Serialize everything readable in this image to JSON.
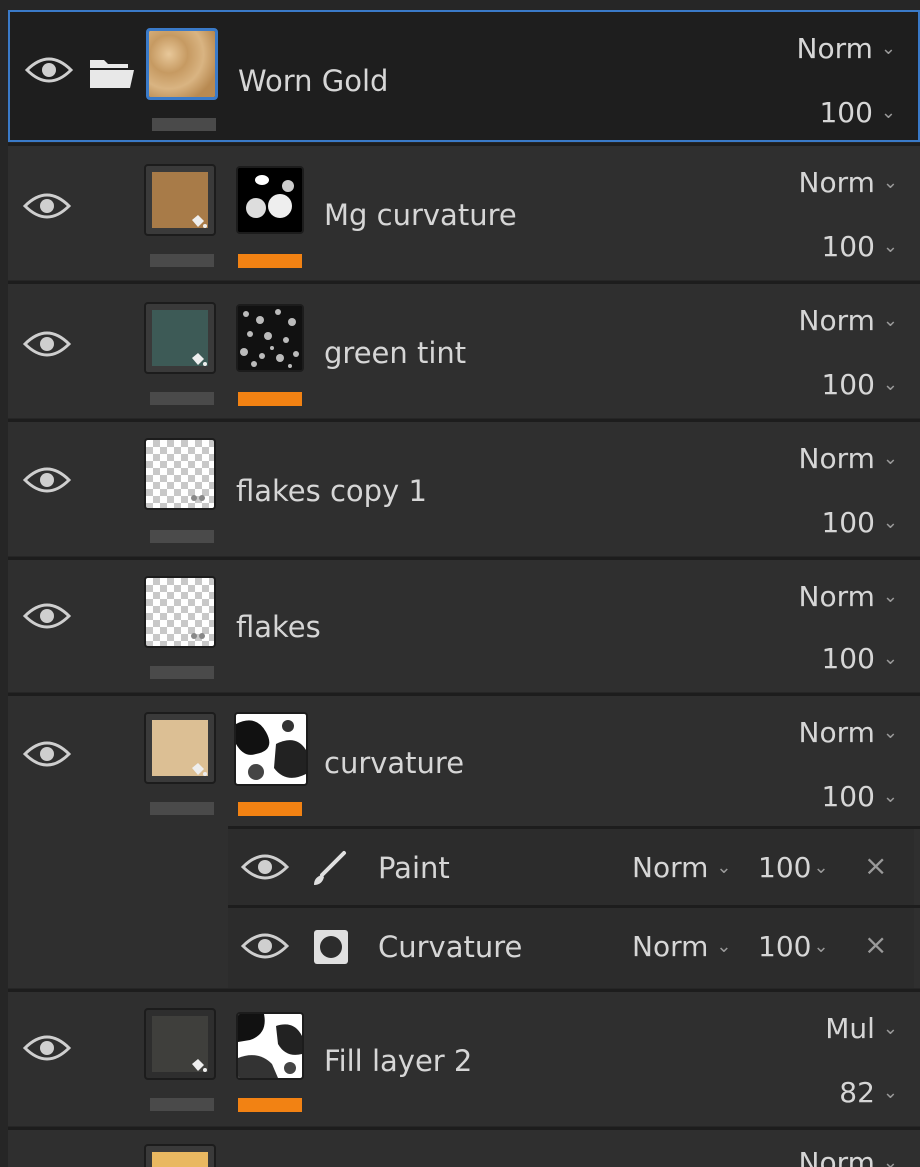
{
  "colors": {
    "panel_bg": "#262626",
    "row_bg": "#2f2f2f",
    "selected_border": "#3a7ac8",
    "mask_indicator": "#f28213"
  },
  "layers": [
    {
      "name": "Worn Gold",
      "blend": "Norm",
      "opacity": "100",
      "type": "folder",
      "selected": true,
      "icon": "folder-icon"
    },
    {
      "name": "Mg curvature",
      "blend": "Norm",
      "opacity": "100",
      "type": "fill",
      "swatch": "#a87b48"
    },
    {
      "name": "green tint",
      "blend": "Norm",
      "opacity": "100",
      "type": "fill",
      "swatch": "#3d5a56"
    },
    {
      "name": "flakes copy 1",
      "blend": "Norm",
      "opacity": "100",
      "type": "paint"
    },
    {
      "name": "flakes",
      "blend": "Norm",
      "opacity": "100",
      "type": "paint"
    },
    {
      "name": "curvature",
      "blend": "Norm",
      "opacity": "100",
      "type": "fill",
      "swatch": "#dcbf94",
      "effects": [
        {
          "name": "Paint",
          "blend": "Norm",
          "opacity": "100",
          "icon": "brush-icon"
        },
        {
          "name": "Curvature",
          "blend": "Norm",
          "opacity": "100",
          "icon": "generator-icon"
        }
      ]
    },
    {
      "name": "Fill layer 2",
      "blend": "Mul",
      "opacity": "82",
      "type": "fill",
      "swatch": "#3f3f3c"
    },
    {
      "name": "",
      "blend": "Norm",
      "opacity": "",
      "type": "fill",
      "swatch": "#e9b861"
    }
  ],
  "close_glyph": "×"
}
